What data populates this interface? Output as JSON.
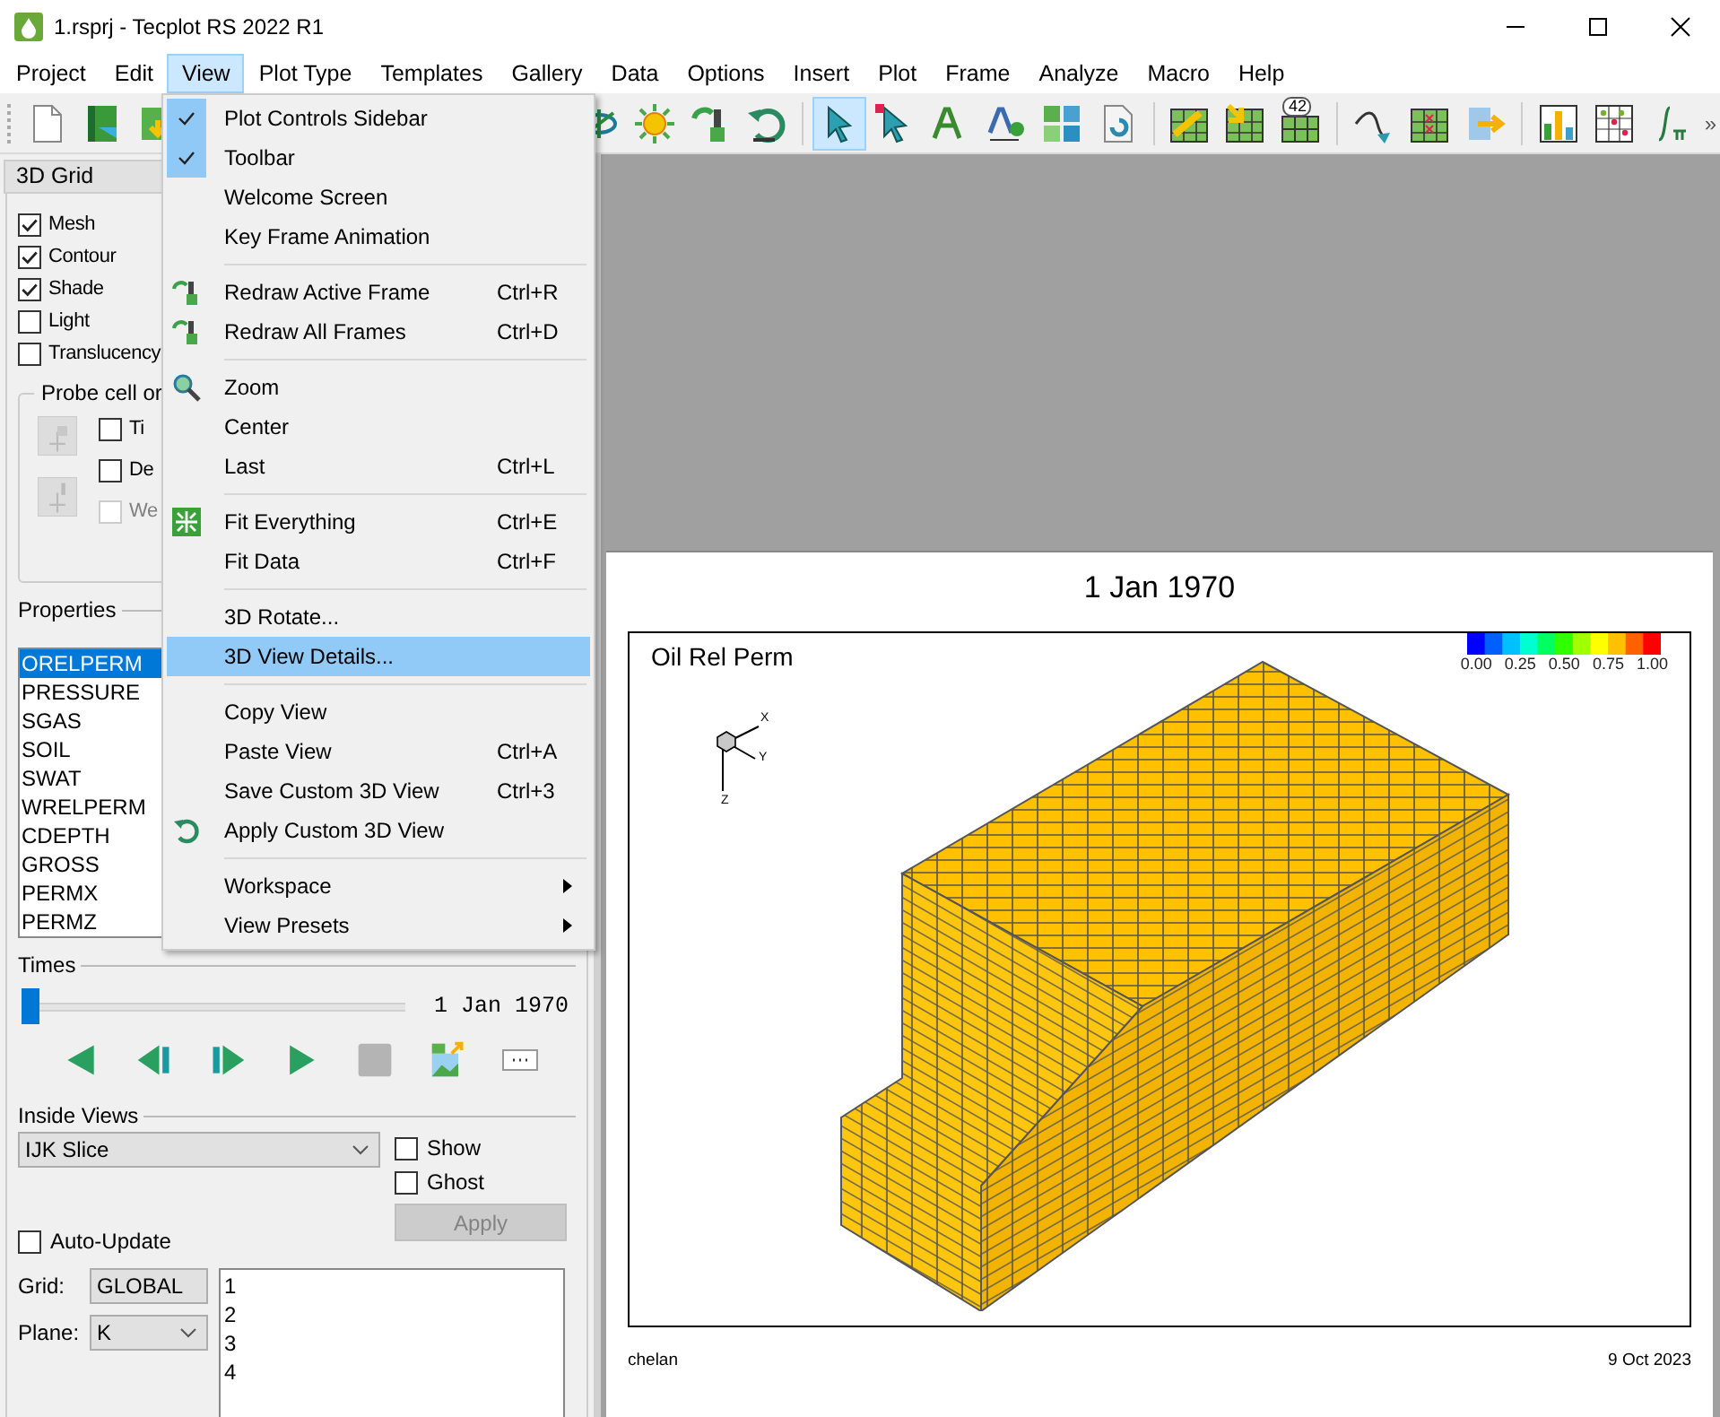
{
  "window": {
    "title": "1.rsprj - Tecplot RS 2022 R1"
  },
  "menubar": [
    {
      "label": "Project",
      "selected": false
    },
    {
      "label": "Edit",
      "selected": false
    },
    {
      "label": "View",
      "selected": true
    },
    {
      "label": "Plot Type",
      "selected": false
    },
    {
      "label": "Templates",
      "selected": false
    },
    {
      "label": "Gallery",
      "selected": false
    },
    {
      "label": "Data",
      "selected": false
    },
    {
      "label": "Options",
      "selected": false
    },
    {
      "label": "Insert",
      "selected": false
    },
    {
      "label": "Plot",
      "selected": false
    },
    {
      "label": "Frame",
      "selected": false
    },
    {
      "label": "Analyze",
      "selected": false
    },
    {
      "label": "Macro",
      "selected": false
    },
    {
      "label": "Help",
      "selected": false
    }
  ],
  "toolbar": {
    "badge": "42",
    "overflow": "»"
  },
  "view_menu": [
    {
      "kind": "item",
      "label": "Plot Controls Sidebar",
      "checked": true,
      "selected": false,
      "submenu": false
    },
    {
      "kind": "item",
      "label": "Toolbar",
      "checked": true,
      "selected": false,
      "submenu": false
    },
    {
      "kind": "item",
      "label": "Welcome Screen",
      "checked": false,
      "selected": false,
      "submenu": false
    },
    {
      "kind": "item",
      "label": "Key Frame Animation",
      "checked": false,
      "selected": false,
      "submenu": false
    },
    {
      "kind": "separator"
    },
    {
      "kind": "redraw",
      "label": "Redraw Active Frame",
      "shortcut": "Ctrl+R",
      "checked": false,
      "selected": false,
      "submenu": false
    },
    {
      "kind": "redraw",
      "label": "Redraw All Frames",
      "shortcut": "Ctrl+D",
      "checked": false,
      "selected": false,
      "submenu": false
    },
    {
      "kind": "separator"
    },
    {
      "kind": "zoom",
      "label": "Zoom",
      "checked": false,
      "selected": false,
      "submenu": false
    },
    {
      "kind": "item",
      "label": "Center",
      "checked": false,
      "selected": false,
      "submenu": false
    },
    {
      "kind": "item",
      "label": "Last",
      "shortcut": "Ctrl+L",
      "checked": false,
      "selected": false,
      "submenu": false
    },
    {
      "kind": "separator"
    },
    {
      "kind": "fit",
      "label": "Fit Everything",
      "shortcut": "Ctrl+E",
      "checked": false,
      "selected": false,
      "submenu": false
    },
    {
      "kind": "item",
      "label": "Fit Data",
      "shortcut": "Ctrl+F",
      "checked": false,
      "selected": false,
      "submenu": false
    },
    {
      "kind": "separator"
    },
    {
      "kind": "item",
      "label": "3D Rotate...",
      "checked": false,
      "selected": false,
      "submenu": false
    },
    {
      "kind": "item",
      "label": "3D View Details...",
      "checked": false,
      "selected": true,
      "submenu": false
    },
    {
      "kind": "separator"
    },
    {
      "kind": "item",
      "label": "Copy View",
      "checked": false,
      "selected": false,
      "submenu": false
    },
    {
      "kind": "item",
      "label": "Paste View",
      "shortcut": "Ctrl+A",
      "checked": false,
      "selected": false,
      "submenu": false
    },
    {
      "kind": "item",
      "label": "Save Custom 3D View",
      "shortcut": "Ctrl+3",
      "checked": false,
      "selected": false,
      "submenu": false
    },
    {
      "kind": "apply",
      "label": "Apply Custom 3D View",
      "checked": false,
      "selected": false,
      "submenu": false
    },
    {
      "kind": "separator"
    },
    {
      "kind": "item",
      "label": "Workspace",
      "checked": false,
      "selected": false,
      "submenu": true
    },
    {
      "kind": "item",
      "label": "View Presets",
      "checked": false,
      "selected": false,
      "submenu": true
    }
  ],
  "sidebar": {
    "tab": "3D Grid",
    "layers": [
      {
        "label": "Mesh",
        "checked": true
      },
      {
        "label": "Contour",
        "checked": true
      },
      {
        "label": "Shade",
        "checked": true
      },
      {
        "label": "Light",
        "checked": false
      },
      {
        "label": "Translucency",
        "checked": false
      }
    ],
    "probe": {
      "title": "Probe cell or",
      "options": [
        {
          "label": "Ti",
          "checked": false,
          "disabled": false
        },
        {
          "label": "De",
          "checked": false,
          "disabled": false
        },
        {
          "label": "We",
          "checked": false,
          "disabled": true
        }
      ]
    },
    "properties": {
      "title": "Properties",
      "items": [
        {
          "label": "ORELPERM",
          "selected": true
        },
        {
          "label": "PRESSURE",
          "selected": false
        },
        {
          "label": "SGAS",
          "selected": false
        },
        {
          "label": "SOIL",
          "selected": false
        },
        {
          "label": "SWAT",
          "selected": false
        },
        {
          "label": "WRELPERM",
          "selected": false
        },
        {
          "label": "CDEPTH",
          "selected": false
        },
        {
          "label": "GROSS",
          "selected": false
        },
        {
          "label": "PERMX",
          "selected": false
        },
        {
          "label": "PERMZ",
          "selected": false
        }
      ]
    },
    "times": {
      "title": "Times",
      "level": 0,
      "date": "1 Jan 1970"
    },
    "inside_views": {
      "title": "Inside Views",
      "mode": "IJK Slice",
      "show": {
        "label": "Show",
        "checked": false
      },
      "ghost": {
        "label": "Ghost",
        "checked": false
      },
      "auto_update": {
        "label": "Auto-Update",
        "checked": false
      },
      "apply": {
        "label": "Apply",
        "disabled": true
      },
      "grid": {
        "label": "Grid:",
        "value": "GLOBAL"
      },
      "plane": {
        "label": "Plane:",
        "value": "K"
      },
      "plane_indices": [
        "1",
        "2",
        "3",
        "4"
      ]
    }
  },
  "frame": {
    "title": "1 Jan 1970",
    "plot_title": "Oil Rel Perm",
    "colorbar_ticks": [
      "0.00",
      "0.25",
      "0.50",
      "0.75",
      "1.00"
    ],
    "axes": [
      "X",
      "Y",
      "Z"
    ],
    "footer_left": "chelan",
    "footer_right": "9 Oct 2023"
  }
}
